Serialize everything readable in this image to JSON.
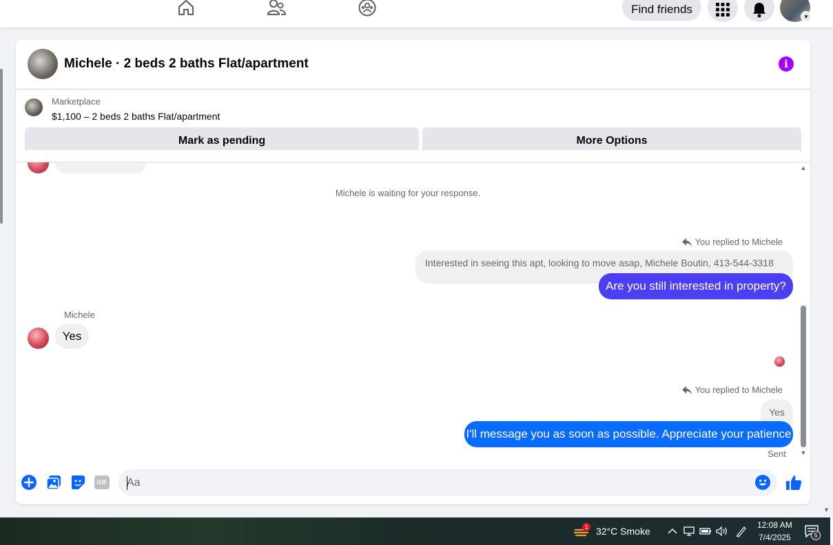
{
  "topnav": {
    "icons": [
      "home-icon",
      "friends-icon",
      "groups-icon"
    ],
    "find_friends_label": "Find friends",
    "menu_icon": "grid-menu-icon",
    "notifications_icon": "bell-icon",
    "account_icon": "profile-avatar"
  },
  "conversation": {
    "title": "Michele · 2 beds 2 baths Flat/apartment",
    "info_icon": "info-icon",
    "marketplace_label": "Marketplace",
    "listing_title": "$1,100 – 2 beds 2 baths Flat/apartment",
    "mark_pending_label": "Mark as pending",
    "more_options_label": "More Options"
  },
  "messages": {
    "waiting_notice": "Michele is waiting for your response.",
    "reply_1": {
      "replied_label": "You replied to Michele",
      "quoted_text": "Interested in seeing this apt, looking to move asap, Michele Boutin,  413-544-3318",
      "text": "Are you still interested in property?"
    },
    "incoming": {
      "sender": "Michele",
      "text": "Yes"
    },
    "reply_2": {
      "replied_label": "You replied to Michele",
      "quoted_text": "Yes",
      "text": "I'll message you as soon as possible. Appreciate your patience",
      "status": "Sent"
    }
  },
  "composer": {
    "placeholder": "Aa",
    "icons": [
      "plus-icon",
      "photo-icon",
      "sticker-icon",
      "gif-icon",
      "emoji-icon",
      "like-icon"
    ],
    "gif_label": "GIF"
  },
  "taskbar": {
    "weather_badge": "1",
    "weather": "32°C  Smoke",
    "time": "12:08 AM",
    "date": "7/4/2025",
    "notification_count": "5"
  },
  "colors": {
    "messenger_purple": "#a200ff",
    "bubble_purple_blue": "#4b3ef5",
    "bubble_blue": "#0a6cff",
    "facebook_blue": "#0866ff"
  }
}
